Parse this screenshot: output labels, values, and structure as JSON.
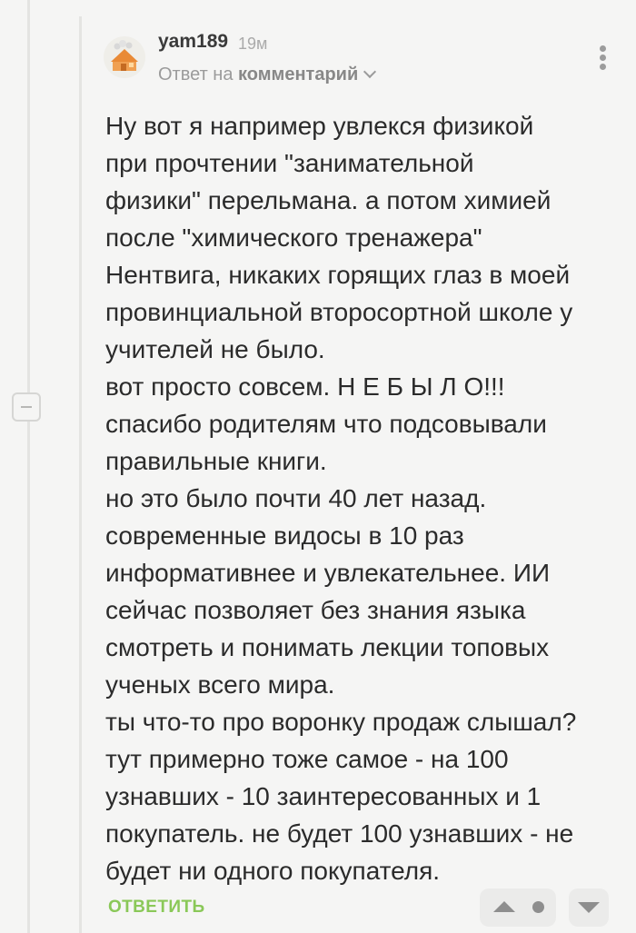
{
  "comment": {
    "author": "yam189",
    "time_ago": "19м",
    "reply_prefix": "Ответ на",
    "reply_target": "комментарий",
    "text": "Ну вот я например увлекся физикой\nпри прочтении \"занимательной\nфизики\" перельмана. а потом химией\nпосле \"химического тренажера\"\nНентвига, никаких горящих глаз в моей\nпровинциальной второсортной школе у\nучителей не было.\nвот просто совсем. Н Е Б Ы Л О!!!\nспасибо родителям что подсовывали\nправильные книги.\nно это было почти 40 лет назад.\nсовременные видосы в 10 раз\nинформативнее и увлекательнее. ИИ\nсейчас позволяет без знания языка\nсмотреть и понимать лекции топовых\nученых всего мира.\nты что-то про воронку продаж слышал?\nтут примерно тоже самое - на 100\nузнавших - 10 заинтересованных и 1\nпокупатель. не будет 100 узнавших - не\nбудет ни одного покупателя.",
    "reply_button": "ОТВЕТИТЬ"
  },
  "icons": {
    "avatar": "house-avatar-icon",
    "more": "more-vertical-icon",
    "expand": "chevron-down-icon",
    "collapse": "minus-icon",
    "upvote": "triangle-up-icon",
    "rating": "dot-icon",
    "downvote": "triangle-down-icon"
  },
  "colors": {
    "background": "#f5f5f4",
    "text": "#2b2b2b",
    "reply_accent": "#8ac858",
    "muted": "#9b9b9b",
    "vote_box": "#ebebea"
  }
}
